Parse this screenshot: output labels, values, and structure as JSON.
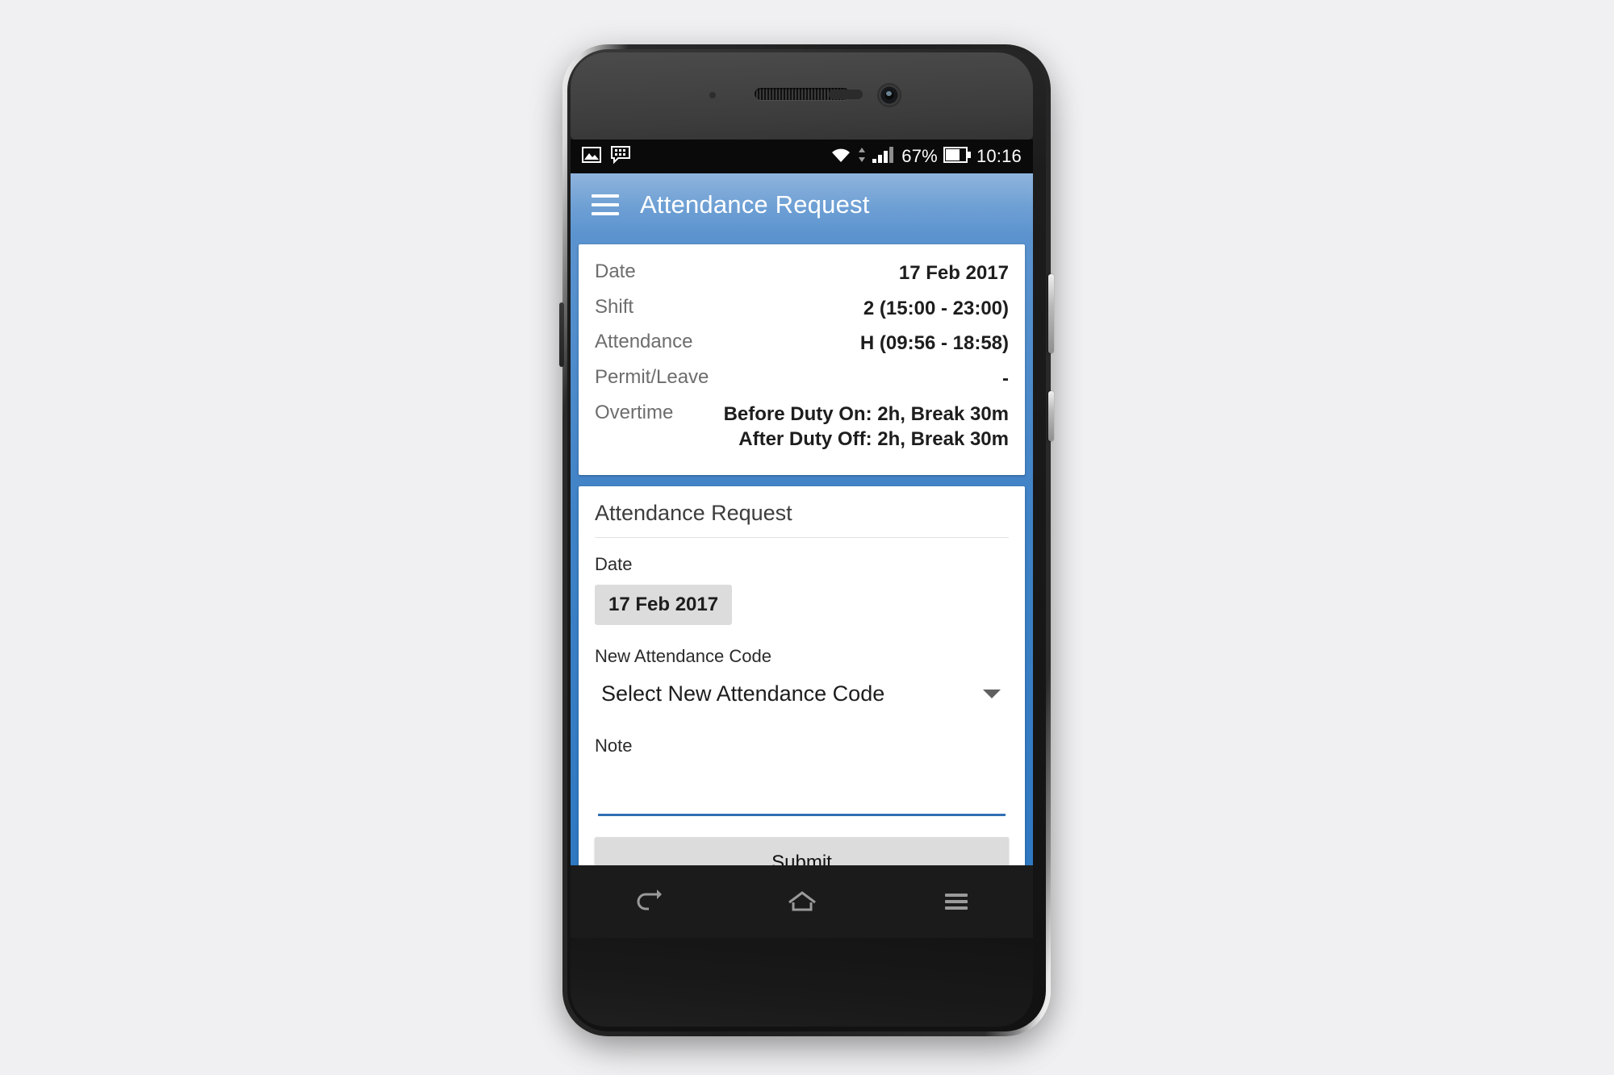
{
  "status_bar": {
    "icons_left": [
      "image-icon",
      "messaging-icon"
    ],
    "wifi_icon": "wifi-icon",
    "signal_icon": "cellular-signal-icon",
    "battery_percent": "67%",
    "battery_icon": "battery-icon",
    "time": "10:16"
  },
  "app_bar": {
    "menu_icon": "hamburger-menu-icon",
    "title": "Attendance Request"
  },
  "detail_card": {
    "rows": [
      {
        "label": "Date",
        "value": "17 Feb 2017"
      },
      {
        "label": "Shift",
        "value": "2 (15:00 - 23:00)"
      },
      {
        "label": "Attendance",
        "value": "H (09:56 - 18:58)"
      },
      {
        "label": "Permit/Leave",
        "value": "-"
      },
      {
        "label": "Overtime",
        "value": "Before Duty On: 2h, Break 30m\nAfter Duty Off: 2h, Break 30m"
      }
    ]
  },
  "form_card": {
    "title": "Attendance Request",
    "date_label": "Date",
    "date_value": "17 Feb 2017",
    "code_label": "New Attendance Code",
    "code_selected": "Select New Attendance Code",
    "code_caret_icon": "chevron-down-icon",
    "note_label": "Note",
    "note_value": "",
    "note_placeholder": "",
    "submit_label": "Submit"
  },
  "nav_bar": {
    "back_icon": "back-arrow-icon",
    "home_icon": "home-icon",
    "recents_icon": "recents-menu-icon"
  },
  "colors": {
    "accent_blue": "#2f78c2",
    "app_bar_blue": "#6d9fd4",
    "chip_gray": "#dcdcdc",
    "page_background": "#f0f0f2"
  }
}
